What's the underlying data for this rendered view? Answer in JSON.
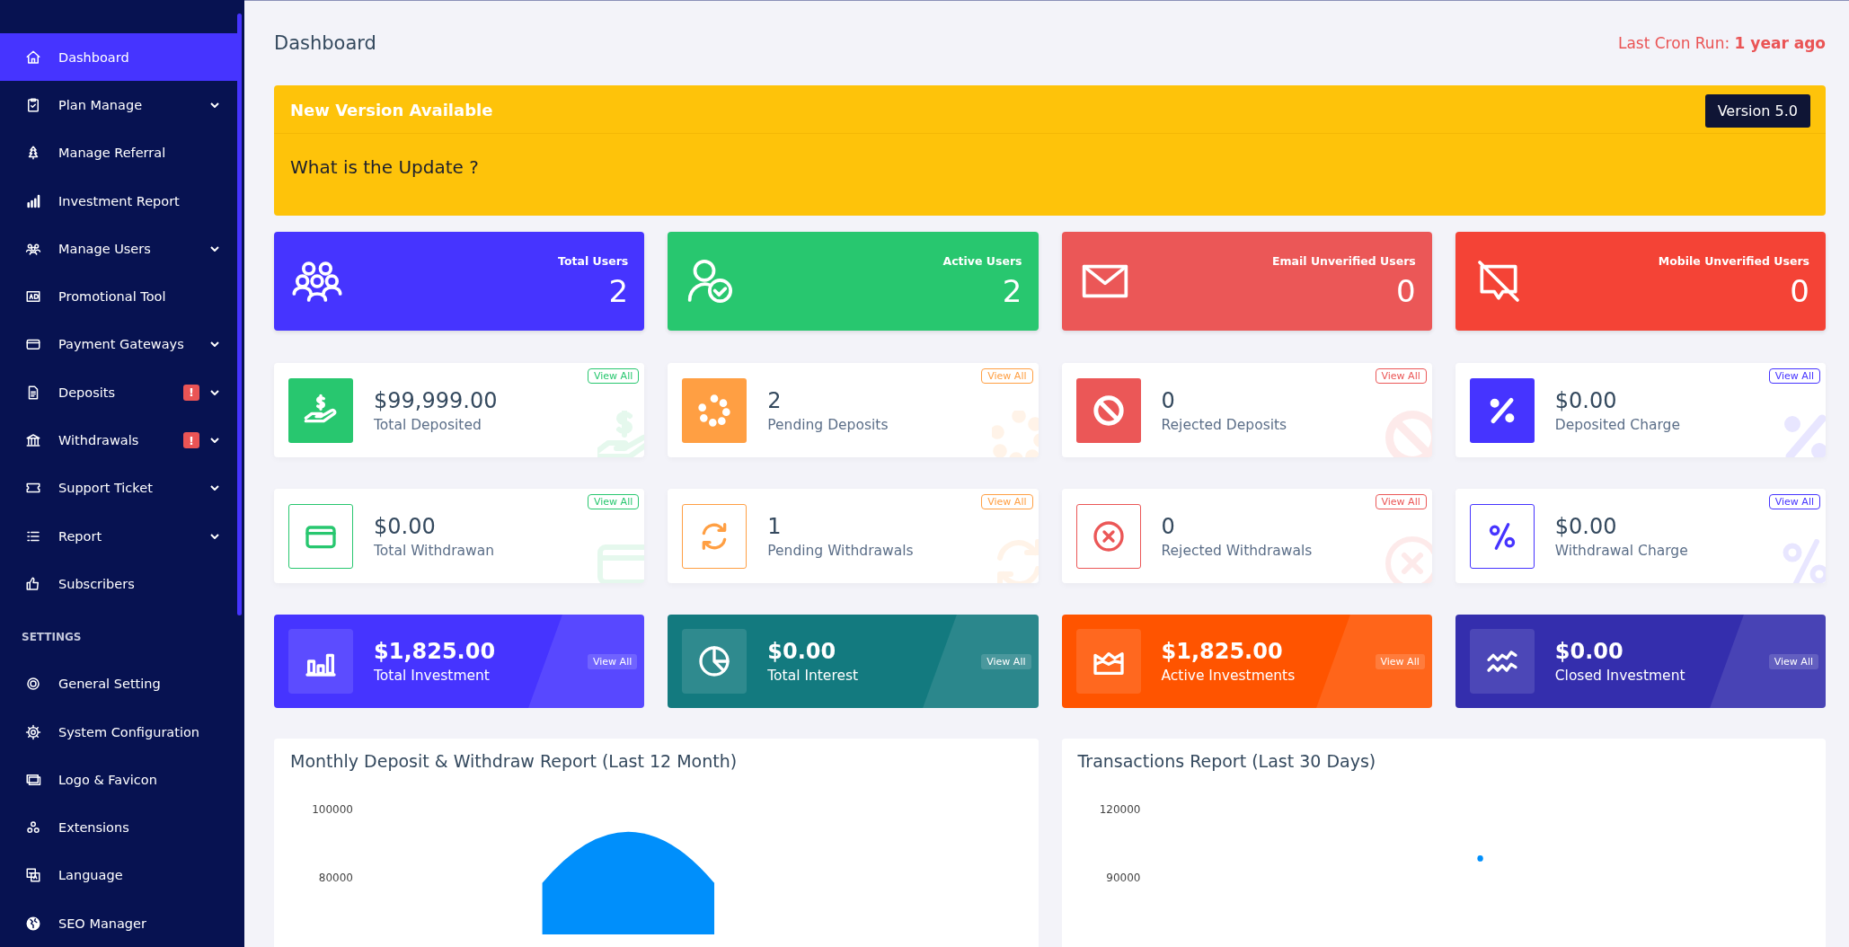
{
  "sidebar": {
    "items": [
      {
        "label": "Dashboard",
        "selected": true,
        "has_submenu": false
      },
      {
        "label": "Plan Manage",
        "selected": false,
        "has_submenu": true
      },
      {
        "label": "Manage Referral",
        "selected": false,
        "has_submenu": false
      },
      {
        "label": "Investment Report",
        "selected": false,
        "has_submenu": false
      },
      {
        "label": "Manage Users",
        "selected": false,
        "has_submenu": true
      },
      {
        "label": "Promotional Tool",
        "selected": false,
        "has_submenu": false
      },
      {
        "label": "Payment Gateways",
        "selected": false,
        "has_submenu": true
      },
      {
        "label": "Deposits",
        "selected": false,
        "has_submenu": true,
        "alert": "!"
      },
      {
        "label": "Withdrawals",
        "selected": false,
        "has_submenu": true,
        "alert": "!"
      },
      {
        "label": "Support Ticket",
        "selected": false,
        "has_submenu": true
      },
      {
        "label": "Report",
        "selected": false,
        "has_submenu": true
      },
      {
        "label": "Subscribers",
        "selected": false,
        "has_submenu": false
      }
    ],
    "section_title": "SETTINGS",
    "settings_items": [
      {
        "label": "General Setting",
        "selected": false,
        "has_submenu": false
      },
      {
        "label": "System Configuration",
        "selected": false,
        "has_submenu": false
      },
      {
        "label": "Logo & Favicon",
        "selected": false,
        "has_submenu": false
      },
      {
        "label": "Extensions",
        "selected": false,
        "has_submenu": false
      },
      {
        "label": "Language",
        "selected": false,
        "has_submenu": false
      },
      {
        "label": "SEO Manager",
        "selected": false,
        "has_submenu": false
      }
    ]
  },
  "header": {
    "title": "Dashboard",
    "cron_label": "Last Cron Run:",
    "cron_value": "1 year ago"
  },
  "update_banner": {
    "title": "New Version Available",
    "version": "Version 5.0",
    "question": "What is the Update ?"
  },
  "user_stats": [
    {
      "label": "Total Users",
      "value": "2",
      "color": "#4634ff"
    },
    {
      "label": "Active Users",
      "value": "2",
      "color": "#28c76f"
    },
    {
      "label": "Email Unverified Users",
      "value": "0",
      "color": "#eb5757"
    },
    {
      "label": "Mobile Unverified Users",
      "value": "0",
      "color": "#f44336"
    }
  ],
  "widgets": [
    {
      "value": "$99,999.00",
      "label": "Total Deposited",
      "link": "View All",
      "color": "#28c76f",
      "kind": "filled"
    },
    {
      "value": "2",
      "label": "Pending Deposits",
      "link": "View All",
      "color": "#ff9f43",
      "kind": "filled"
    },
    {
      "value": "0",
      "label": "Rejected Deposits",
      "link": "View All",
      "color": "#eb5757",
      "kind": "filled"
    },
    {
      "value": "$0.00",
      "label": "Deposited Charge",
      "link": "View All",
      "color": "#4634ff",
      "kind": "filled"
    },
    {
      "value": "$0.00",
      "label": "Total Withdrawan",
      "link": "View All",
      "color": "#28c76f",
      "kind": "outline"
    },
    {
      "value": "1",
      "label": "Pending Withdrawals",
      "link": "View All",
      "color": "#ff9f43",
      "kind": "outline"
    },
    {
      "value": "0",
      "label": "Rejected Withdrawals",
      "link": "View All",
      "color": "#eb5757",
      "kind": "outline"
    },
    {
      "value": "$0.00",
      "label": "Withdrawal Charge",
      "link": "View All",
      "color": "#4634ff",
      "kind": "outline"
    }
  ],
  "investment_cards": [
    {
      "value": "$1,825.00",
      "label": "Total Investment",
      "link": "View All",
      "color": "#4634ff"
    },
    {
      "value": "$0.00",
      "label": "Total Interest",
      "link": "View All",
      "color": "#137a7f"
    },
    {
      "value": "$1,825.00",
      "label": "Active Investments",
      "link": "View All",
      "color": "#ff5400"
    },
    {
      "value": "$0.00",
      "label": "Closed Investment",
      "link": "View All",
      "color": "#342ead"
    }
  ],
  "charts": [
    {
      "title": "Monthly Deposit & Withdraw Report (Last 12 Month)",
      "y_labels": [
        "100000",
        "80000"
      ]
    },
    {
      "title": "Transactions Report (Last 30 Days)",
      "y_labels": [
        "120000",
        "90000"
      ]
    }
  ]
}
